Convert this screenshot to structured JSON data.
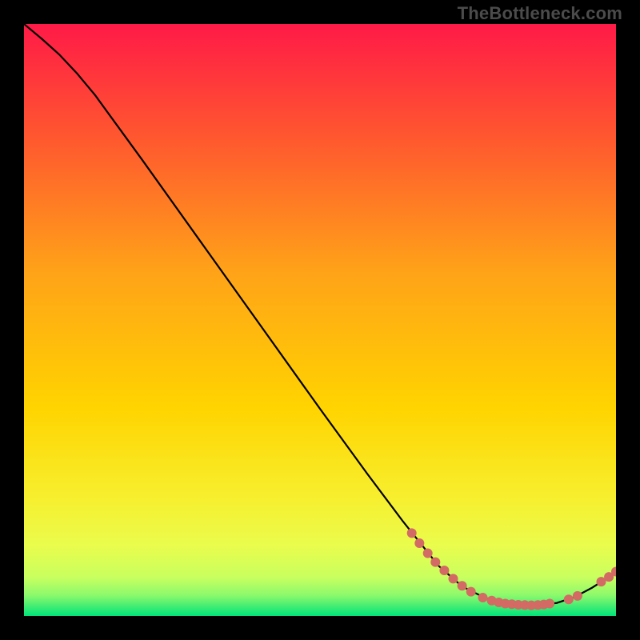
{
  "watermark": "TheBottleneck.com",
  "chart_data": {
    "type": "line",
    "title": "",
    "xlabel": "",
    "ylabel": "",
    "xlim": [
      0,
      100
    ],
    "ylim": [
      0,
      100
    ],
    "grid": false,
    "legend": false,
    "background_gradient": {
      "top": "#ff1a47",
      "mid": "#ffd400",
      "bottom": "#00e37a"
    },
    "curve": [
      {
        "x": 0.0,
        "y": 100.0
      },
      {
        "x": 3.0,
        "y": 97.5
      },
      {
        "x": 6.0,
        "y": 94.8
      },
      {
        "x": 9.0,
        "y": 91.6
      },
      {
        "x": 12.0,
        "y": 88.0
      },
      {
        "x": 20.0,
        "y": 77.0
      },
      {
        "x": 30.0,
        "y": 63.0
      },
      {
        "x": 40.0,
        "y": 49.0
      },
      {
        "x": 50.0,
        "y": 35.0
      },
      {
        "x": 58.0,
        "y": 24.0
      },
      {
        "x": 64.0,
        "y": 16.0
      },
      {
        "x": 70.0,
        "y": 8.5
      },
      {
        "x": 74.0,
        "y": 5.0
      },
      {
        "x": 78.0,
        "y": 3.0
      },
      {
        "x": 82.0,
        "y": 2.0
      },
      {
        "x": 86.0,
        "y": 1.8
      },
      {
        "x": 90.0,
        "y": 2.2
      },
      {
        "x": 93.0,
        "y": 3.2
      },
      {
        "x": 96.0,
        "y": 4.8
      },
      {
        "x": 98.5,
        "y": 6.4
      },
      {
        "x": 100.0,
        "y": 7.5
      }
    ],
    "markers": [
      {
        "x": 65.5,
        "y": 14.0
      },
      {
        "x": 66.8,
        "y": 12.3
      },
      {
        "x": 68.2,
        "y": 10.6
      },
      {
        "x": 69.5,
        "y": 9.1
      },
      {
        "x": 71.0,
        "y": 7.7
      },
      {
        "x": 72.5,
        "y": 6.3
      },
      {
        "x": 74.0,
        "y": 5.1
      },
      {
        "x": 75.5,
        "y": 4.1
      },
      {
        "x": 77.5,
        "y": 3.1
      },
      {
        "x": 79.0,
        "y": 2.6
      },
      {
        "x": 80.2,
        "y": 2.3
      },
      {
        "x": 81.3,
        "y": 2.1
      },
      {
        "x": 82.4,
        "y": 2.0
      },
      {
        "x": 83.5,
        "y": 1.9
      },
      {
        "x": 84.6,
        "y": 1.85
      },
      {
        "x": 85.7,
        "y": 1.8
      },
      {
        "x": 86.8,
        "y": 1.85
      },
      {
        "x": 87.8,
        "y": 1.95
      },
      {
        "x": 88.8,
        "y": 2.1
      },
      {
        "x": 92.0,
        "y": 2.8
      },
      {
        "x": 93.5,
        "y": 3.4
      },
      {
        "x": 97.5,
        "y": 5.8
      },
      {
        "x": 98.8,
        "y": 6.6
      },
      {
        "x": 100.0,
        "y": 7.5
      }
    ],
    "marker_color": "#d36a63",
    "line_color": "#000000"
  }
}
